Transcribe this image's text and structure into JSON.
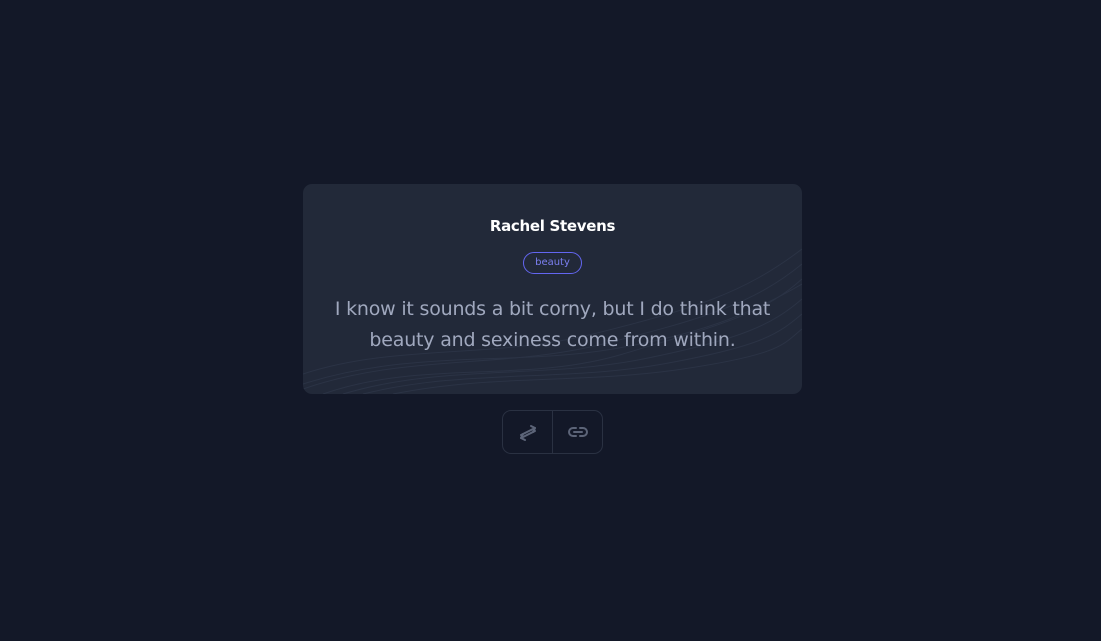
{
  "quote_card": {
    "author": "Rachel Stevens",
    "tag": "beauty",
    "text": "I know it sounds a bit corny, but I do think that beauty and sexiness come from within."
  },
  "actions": {
    "buttons": [
      {
        "icon": "arrows-exchange-icon"
      },
      {
        "icon": "link-icon"
      }
    ]
  },
  "colors": {
    "background": "#131828",
    "card": "#222939",
    "accent": "#6366f1",
    "author_text": "#ffffff",
    "quote_text": "#a0a8be",
    "icon": "#5c6478"
  }
}
